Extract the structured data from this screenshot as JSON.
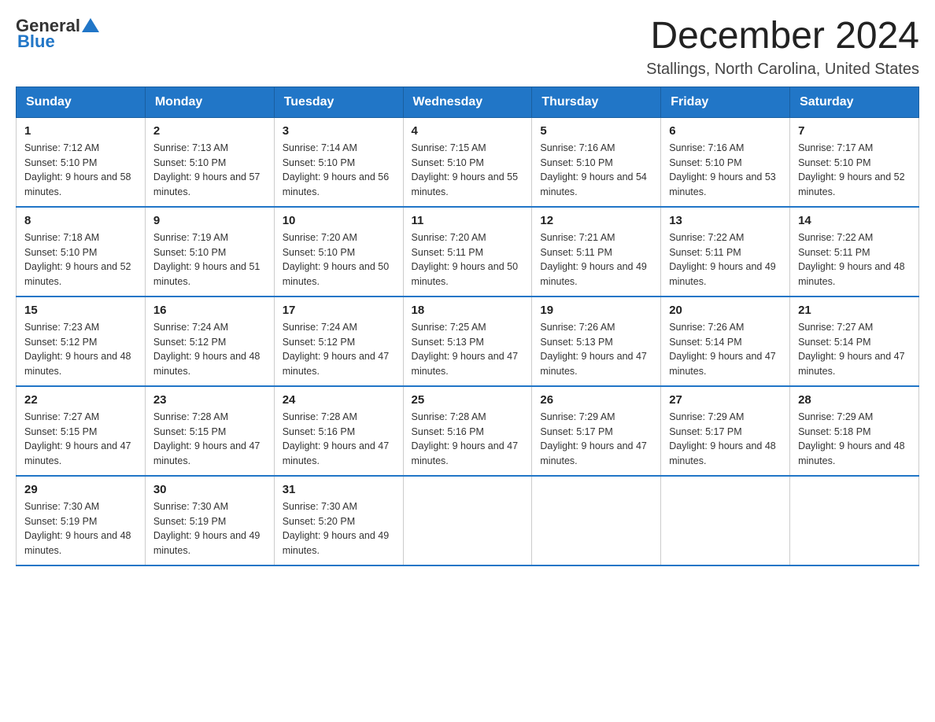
{
  "header": {
    "logo": {
      "text_general": "General",
      "text_blue": "Blue",
      "aria": "GeneralBlue logo"
    },
    "title": "December 2024",
    "subtitle": "Stallings, North Carolina, United States"
  },
  "calendar": {
    "days_of_week": [
      "Sunday",
      "Monday",
      "Tuesday",
      "Wednesday",
      "Thursday",
      "Friday",
      "Saturday"
    ],
    "weeks": [
      [
        {
          "day": "1",
          "sunrise": "7:12 AM",
          "sunset": "5:10 PM",
          "daylight": "9 hours and 58 minutes."
        },
        {
          "day": "2",
          "sunrise": "7:13 AM",
          "sunset": "5:10 PM",
          "daylight": "9 hours and 57 minutes."
        },
        {
          "day": "3",
          "sunrise": "7:14 AM",
          "sunset": "5:10 PM",
          "daylight": "9 hours and 56 minutes."
        },
        {
          "day": "4",
          "sunrise": "7:15 AM",
          "sunset": "5:10 PM",
          "daylight": "9 hours and 55 minutes."
        },
        {
          "day": "5",
          "sunrise": "7:16 AM",
          "sunset": "5:10 PM",
          "daylight": "9 hours and 54 minutes."
        },
        {
          "day": "6",
          "sunrise": "7:16 AM",
          "sunset": "5:10 PM",
          "daylight": "9 hours and 53 minutes."
        },
        {
          "day": "7",
          "sunrise": "7:17 AM",
          "sunset": "5:10 PM",
          "daylight": "9 hours and 52 minutes."
        }
      ],
      [
        {
          "day": "8",
          "sunrise": "7:18 AM",
          "sunset": "5:10 PM",
          "daylight": "9 hours and 52 minutes."
        },
        {
          "day": "9",
          "sunrise": "7:19 AM",
          "sunset": "5:10 PM",
          "daylight": "9 hours and 51 minutes."
        },
        {
          "day": "10",
          "sunrise": "7:20 AM",
          "sunset": "5:10 PM",
          "daylight": "9 hours and 50 minutes."
        },
        {
          "day": "11",
          "sunrise": "7:20 AM",
          "sunset": "5:11 PM",
          "daylight": "9 hours and 50 minutes."
        },
        {
          "day": "12",
          "sunrise": "7:21 AM",
          "sunset": "5:11 PM",
          "daylight": "9 hours and 49 minutes."
        },
        {
          "day": "13",
          "sunrise": "7:22 AM",
          "sunset": "5:11 PM",
          "daylight": "9 hours and 49 minutes."
        },
        {
          "day": "14",
          "sunrise": "7:22 AM",
          "sunset": "5:11 PM",
          "daylight": "9 hours and 48 minutes."
        }
      ],
      [
        {
          "day": "15",
          "sunrise": "7:23 AM",
          "sunset": "5:12 PM",
          "daylight": "9 hours and 48 minutes."
        },
        {
          "day": "16",
          "sunrise": "7:24 AM",
          "sunset": "5:12 PM",
          "daylight": "9 hours and 48 minutes."
        },
        {
          "day": "17",
          "sunrise": "7:24 AM",
          "sunset": "5:12 PM",
          "daylight": "9 hours and 47 minutes."
        },
        {
          "day": "18",
          "sunrise": "7:25 AM",
          "sunset": "5:13 PM",
          "daylight": "9 hours and 47 minutes."
        },
        {
          "day": "19",
          "sunrise": "7:26 AM",
          "sunset": "5:13 PM",
          "daylight": "9 hours and 47 minutes."
        },
        {
          "day": "20",
          "sunrise": "7:26 AM",
          "sunset": "5:14 PM",
          "daylight": "9 hours and 47 minutes."
        },
        {
          "day": "21",
          "sunrise": "7:27 AM",
          "sunset": "5:14 PM",
          "daylight": "9 hours and 47 minutes."
        }
      ],
      [
        {
          "day": "22",
          "sunrise": "7:27 AM",
          "sunset": "5:15 PM",
          "daylight": "9 hours and 47 minutes."
        },
        {
          "day": "23",
          "sunrise": "7:28 AM",
          "sunset": "5:15 PM",
          "daylight": "9 hours and 47 minutes."
        },
        {
          "day": "24",
          "sunrise": "7:28 AM",
          "sunset": "5:16 PM",
          "daylight": "9 hours and 47 minutes."
        },
        {
          "day": "25",
          "sunrise": "7:28 AM",
          "sunset": "5:16 PM",
          "daylight": "9 hours and 47 minutes."
        },
        {
          "day": "26",
          "sunrise": "7:29 AM",
          "sunset": "5:17 PM",
          "daylight": "9 hours and 47 minutes."
        },
        {
          "day": "27",
          "sunrise": "7:29 AM",
          "sunset": "5:17 PM",
          "daylight": "9 hours and 48 minutes."
        },
        {
          "day": "28",
          "sunrise": "7:29 AM",
          "sunset": "5:18 PM",
          "daylight": "9 hours and 48 minutes."
        }
      ],
      [
        {
          "day": "29",
          "sunrise": "7:30 AM",
          "sunset": "5:19 PM",
          "daylight": "9 hours and 48 minutes."
        },
        {
          "day": "30",
          "sunrise": "7:30 AM",
          "sunset": "5:19 PM",
          "daylight": "9 hours and 49 minutes."
        },
        {
          "day": "31",
          "sunrise": "7:30 AM",
          "sunset": "5:20 PM",
          "daylight": "9 hours and 49 minutes."
        },
        null,
        null,
        null,
        null
      ]
    ]
  }
}
